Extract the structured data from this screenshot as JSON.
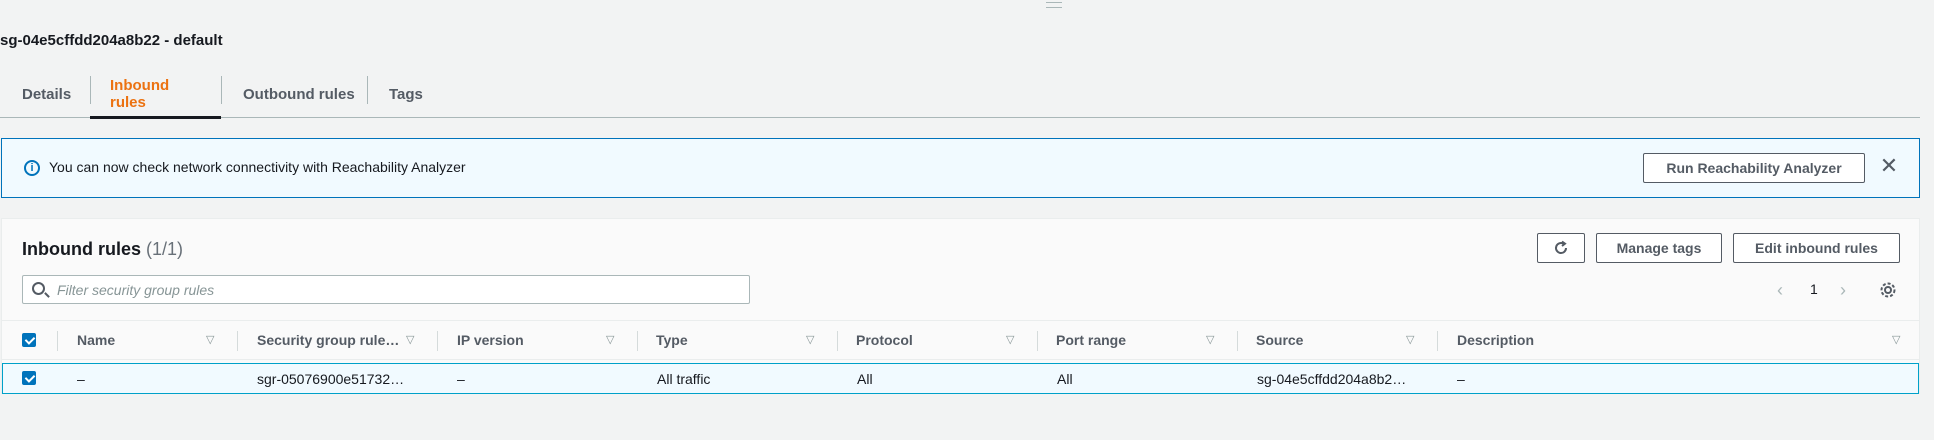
{
  "page": {
    "title": "sg-04e5cffdd204a8b22 - default"
  },
  "tabs": [
    {
      "label": "Details"
    },
    {
      "label": "Inbound rules",
      "active": true
    },
    {
      "label": "Outbound rules"
    },
    {
      "label": "Tags"
    }
  ],
  "alert": {
    "icon": "info-icon",
    "message": "You can now check network connectivity with Reachability Analyzer",
    "action_label": "Run Reachability Analyzer",
    "close_symbol": "✕"
  },
  "rules_panel": {
    "title": "Inbound rules",
    "count": "(1/1)",
    "buttons": {
      "refresh_icon": "refresh-icon",
      "manage_tags": "Manage tags",
      "edit_rules": "Edit inbound rules"
    },
    "search": {
      "placeholder": "Filter security group rules",
      "value": ""
    },
    "pagination": {
      "current_page": "1"
    },
    "table": {
      "columns": [
        "Name",
        "Security group rule…",
        "IP version",
        "Type",
        "Protocol",
        "Port range",
        "Source",
        "Description"
      ],
      "rows": [
        {
          "selected": true,
          "name": "–",
          "rule_id": "sgr-05076900e51732…",
          "ip_version": "–",
          "type": "All traffic",
          "protocol": "All",
          "port_range": "All",
          "source": "sg-04e5cffdd204a8b2…",
          "description": "–"
        }
      ]
    }
  },
  "colors": {
    "accent_orange": "#ec7211",
    "info_blue": "#0073bb",
    "selected_row_bg": "#f1faff"
  }
}
